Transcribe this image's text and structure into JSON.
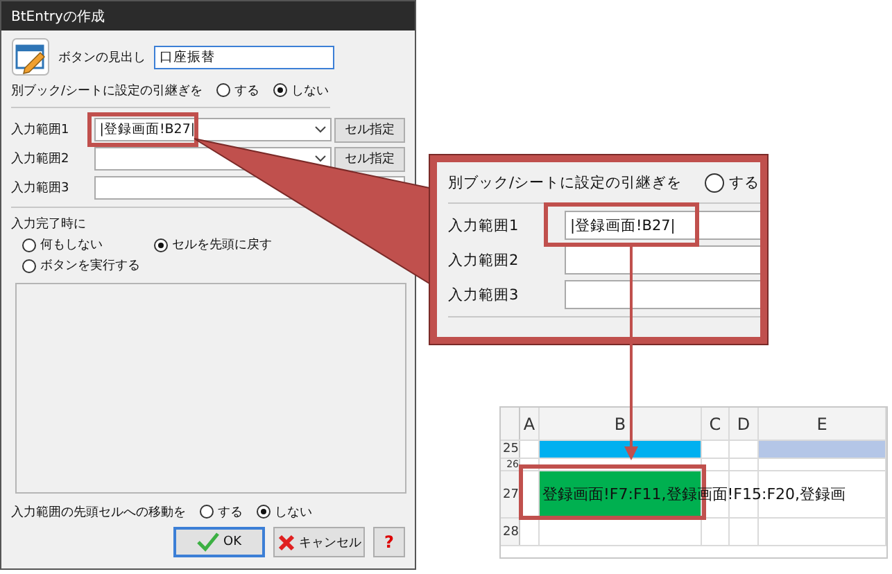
{
  "dialog": {
    "title": "BtEntryの作成",
    "caption_label": "ボタンの見出し",
    "caption_value": "口座振替",
    "carry_over": {
      "label": "別ブック/シートに設定の引継ぎを",
      "options": [
        {
          "label": "する",
          "selected": false
        },
        {
          "label": "しない",
          "selected": true
        }
      ]
    },
    "ranges": [
      {
        "label": "入力範囲1",
        "value": "|登録画面!B27|",
        "kind": "combo",
        "button": "セル指定"
      },
      {
        "label": "入力範囲2",
        "kind": "combo",
        "button": "セル指定"
      },
      {
        "label": "入力範囲3",
        "kind": "text"
      }
    ],
    "on_complete": {
      "label": "入力完了時に",
      "options": [
        {
          "label": "何もしない",
          "selected": false
        },
        {
          "label": "セルを先頭に戻す",
          "selected": true
        },
        {
          "label": "ボタンを実行する",
          "selected": false
        }
      ]
    },
    "move_to_first": {
      "label": "入力範囲の先頭セルへの移動を",
      "options": [
        {
          "label": "する",
          "selected": false
        },
        {
          "label": "しない",
          "selected": true
        }
      ]
    },
    "buttons": [
      {
        "label": "OK",
        "kind": "ok"
      },
      {
        "label": "キャンセル",
        "kind": "cancel"
      },
      {
        "label": "?",
        "kind": "help"
      }
    ]
  },
  "callout": {
    "carry_over": {
      "label": "別ブック/シートに設定の引継ぎを",
      "options": [
        {
          "label": "する",
          "selected": false
        }
      ]
    },
    "ranges": [
      {
        "label": "入力範囲1",
        "value": "|登録画面!B27|"
      },
      {
        "label": "入力範囲2"
      },
      {
        "label": "入力範囲3"
      }
    ]
  },
  "sheet": {
    "columns": [
      "A",
      "B",
      "C",
      "D",
      "E"
    ],
    "rows": [
      {
        "number": "25",
        "b_fill": {
          "color": "#00b0f0"
        },
        "e_fill": {
          "color": "#b4c6e7"
        }
      },
      {
        "number": "26"
      },
      {
        "number": "27",
        "b_fill": {
          "color": "#00b050"
        },
        "b_text": "登録画面!F7:F11,登録画面!F15:F20,登録画"
      },
      {
        "number": "28"
      }
    ]
  }
}
